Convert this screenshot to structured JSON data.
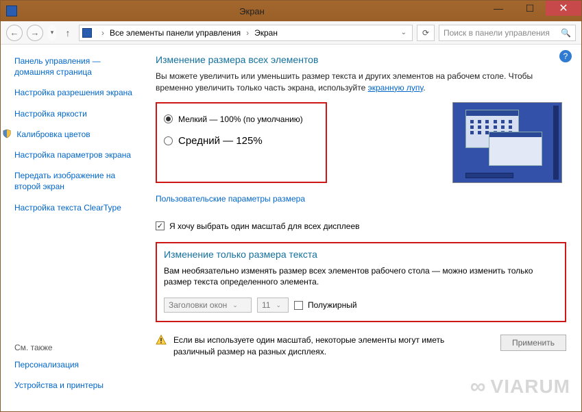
{
  "window": {
    "title": "Экран"
  },
  "nav": {
    "crumb1": "Все элементы панели управления",
    "crumb2": "Экран",
    "search_placeholder": "Поиск в панели управления"
  },
  "sidebar": {
    "link_cp_home": "Панель управления — домашняя страница",
    "link_resolution": "Настройка разрешения экрана",
    "link_brightness": "Настройка яркости",
    "link_calibration": "Калибровка цветов",
    "link_params": "Настройка параметров экрана",
    "link_project": "Передать изображение на второй экран",
    "link_cleartype": "Настройка текста ClearType",
    "footer_hdr": "См. также",
    "link_personal": "Персонализация",
    "link_devices": "Устройства и принтеры"
  },
  "main": {
    "heading1": "Изменение размера всех элементов",
    "desc1_a": "Вы можете увеличить или уменьшить размер текста и других элементов на рабочем столе. Чтобы временно увеличить только часть экрана, используйте ",
    "desc1_link": "экранную лупу",
    "radio_small": "Мелкий — 100% (по умолчанию)",
    "radio_medium": "Средний — 125%",
    "link_custom": "Пользовательские параметры размера",
    "chk_single_scale": "Я хочу выбрать один масштаб для всех дисплеев",
    "heading2": "Изменение только размера текста",
    "desc2": "Вам необязательно изменять размер всех элементов рабочего стола — можно изменить только размер текста определенного элемента.",
    "combo_element": "Заголовки окон",
    "combo_size": "11",
    "chk_bold": "Полужирный",
    "warn": "Если вы используете один масштаб, некоторые элементы могут иметь различный размер на разных дисплеях.",
    "apply": "Применить"
  },
  "watermark": "VIARUM"
}
